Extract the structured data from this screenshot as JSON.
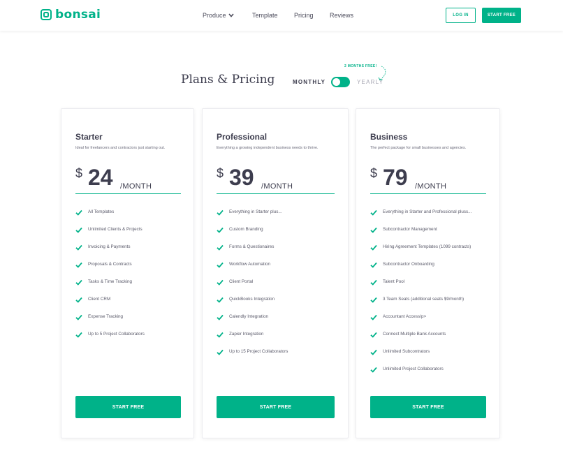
{
  "brand": {
    "name": "bonsai",
    "color": "#00b289",
    "logo_icon": "bonsai-logo-icon"
  },
  "nav": {
    "items": [
      {
        "label": "Produce",
        "has_dropdown": true
      },
      {
        "label": "Template"
      },
      {
        "label": "Pricing"
      },
      {
        "label": "Reviews"
      }
    ],
    "login_label": "LOG IN",
    "start_label": "START FREE"
  },
  "pricing_header": {
    "title": "Plans & Pricing",
    "monthly_label": "MONTHLY",
    "yearly_label": "YEARLY",
    "promo": "2 MONTHS FREE!",
    "toggle_state": "monthly"
  },
  "plans": [
    {
      "name": "Starter",
      "description": "Ideal for freelancers and contractors just starting out.",
      "currency": "$",
      "price": "24",
      "period": "/MONTH",
      "features": [
        "All Templates",
        "Unlimited Clients & Projects",
        "Invoicing & Payments",
        "Proposals & Contracts",
        "Tasks & Time Tracking",
        "Client CRM",
        "Expense Tracking",
        "Up to 5 Project Collaborators"
      ],
      "cta": "START FREE"
    },
    {
      "name": "Professional",
      "description": "Everything a growing independent business needs to thrive.",
      "currency": "$",
      "price": "39",
      "period": "/MONTH",
      "features": [
        "Everything in Starter plus...",
        "Custom Branding",
        "Forms & Questionaires",
        "Workflow Automation",
        "Client Portal",
        "QuickBooks Integration",
        "Calendly Integration",
        "Zapier Integration",
        "Up to 15 Project Collaborators"
      ],
      "cta": "START FREE"
    },
    {
      "name": "Business",
      "description": "The perfect package for small businesses and agencies.",
      "currency": "$",
      "price": "79",
      "period": "/MONTH",
      "features": [
        "Everything in Starter and Professional pluss...",
        "Subcontractor Management",
        "Hiring Agreement Templates (1099 contracts)",
        "Subcontractor Onboarding",
        "Talent Pool",
        "3 Team Seats (additional seats $9/month)",
        "Accountant Access/p>",
        "Connect Multiple Bank Accounts",
        "Unlimited Subcontrators",
        "Unlimited Project Collaborators"
      ],
      "cta": "START FREE"
    }
  ]
}
